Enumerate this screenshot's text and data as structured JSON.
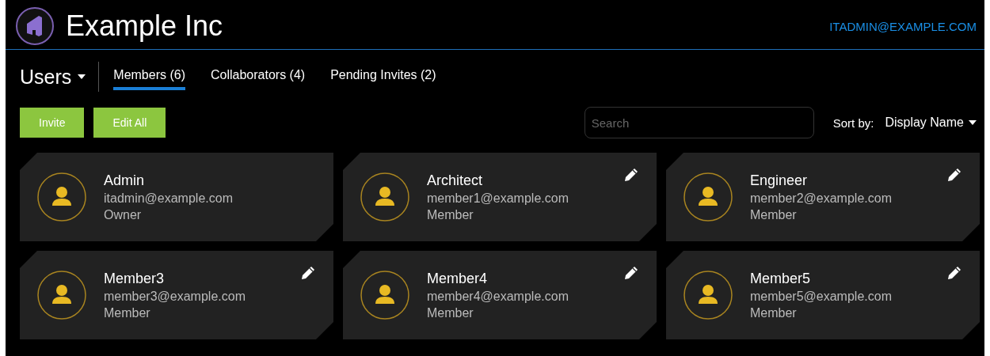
{
  "header": {
    "title": "Example Inc",
    "user": "ITADMIN@EXAMPLE.COM"
  },
  "section": {
    "title": "Users"
  },
  "tabs": [
    {
      "label": "Members (6)",
      "selected": true
    },
    {
      "label": "Collaborators (4)",
      "selected": false
    },
    {
      "label": "Pending Invites (2)",
      "selected": false
    }
  ],
  "buttons": [
    "Invite",
    "Edit All"
  ],
  "search": {
    "placeholder": "Search"
  },
  "sort": {
    "label": "Sort by:",
    "value": "Display Name"
  },
  "members": [
    {
      "name": "Admin",
      "email": "itadmin@example.com",
      "role": "Owner",
      "editable": false
    },
    {
      "name": "Architect",
      "email": "member1@example.com",
      "role": "Member",
      "editable": true
    },
    {
      "name": "Engineer",
      "email": "member2@example.com",
      "role": "Member",
      "editable": true
    },
    {
      "name": "Member3",
      "email": "member3@example.com",
      "role": "Member",
      "editable": true
    },
    {
      "name": "Member4",
      "email": "member4@example.com",
      "role": "Member",
      "editable": true
    },
    {
      "name": "Member5",
      "email": "member5@example.com",
      "role": "Member",
      "editable": true
    }
  ]
}
